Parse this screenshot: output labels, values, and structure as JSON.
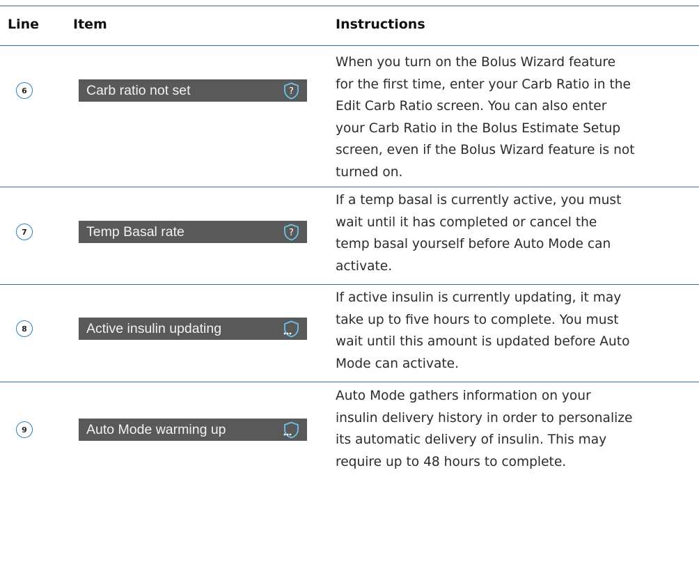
{
  "header": {
    "line": "Line",
    "item": "Item",
    "instructions": "Instructions"
  },
  "colors": {
    "rule": "#2d6fb3",
    "item_background": "#595959",
    "item_text": "#f2f2f2",
    "circle_border": "#2e7fb8"
  },
  "rows": [
    {
      "line": "6",
      "item": "Carb ratio not set",
      "icon": "question-shield-icon",
      "instructions": [
        "When you turn on the Bolus Wizard feature",
        "for the first time, enter your Carb Ratio in the",
        "Edit Carb Ratio screen. You can also enter",
        "your Carb Ratio in the Bolus Estimate Setup",
        "screen, even if the Bolus Wizard feature is not",
        "turned on."
      ]
    },
    {
      "line": "7",
      "item": "Temp Basal rate",
      "icon": "question-shield-icon",
      "instructions": [
        "If a temp basal is currently active, you must",
        "wait until it has completed or cancel the",
        "temp basal yourself before Auto Mode can",
        "activate."
      ]
    },
    {
      "line": "8",
      "item": "Active insulin updating",
      "icon": "loading-shield-icon",
      "instructions": [
        "If active insulin is currently updating, it may",
        "take up to five hours to complete. You must",
        "wait until this amount is updated before Auto",
        "Mode can activate."
      ]
    },
    {
      "line": "9",
      "item": "Auto Mode warming up",
      "icon": "loading-shield-icon",
      "instructions": [
        "Auto Mode gathers information on your",
        "insulin delivery history in order to personalize",
        "its automatic delivery of insulin. This may",
        "require up to 48 hours to complete."
      ]
    }
  ]
}
